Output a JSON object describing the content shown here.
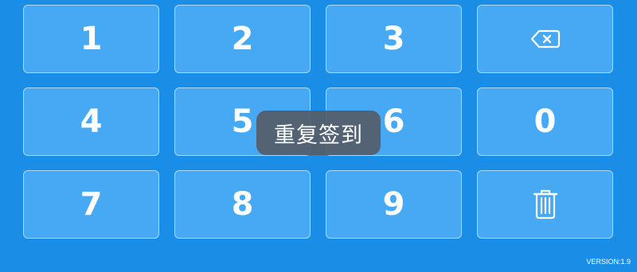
{
  "keypad": {
    "keys": [
      {
        "label": "1"
      },
      {
        "label": "2"
      },
      {
        "label": "3"
      },
      {
        "icon": "backspace-icon"
      },
      {
        "label": "4"
      },
      {
        "label": "5"
      },
      {
        "label": "6"
      },
      {
        "label": "0"
      },
      {
        "label": "7"
      },
      {
        "label": "8"
      },
      {
        "label": "9"
      },
      {
        "icon": "trash-icon"
      }
    ]
  },
  "toast": {
    "message": "重复签到"
  },
  "footer": {
    "version": "VERSION:1.9"
  },
  "colors": {
    "background": "#1a8ee6",
    "key": "#47a9f3",
    "toast": "#555d68",
    "text": "#ffffff"
  }
}
